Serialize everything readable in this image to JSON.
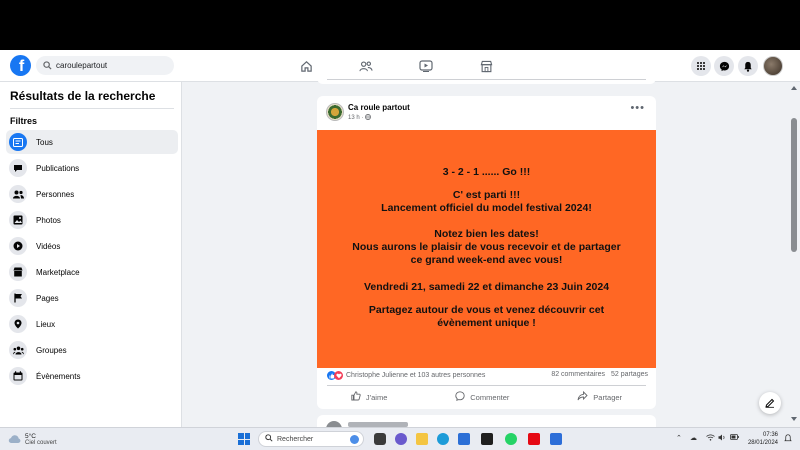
{
  "search": {
    "value": "caroulepartout"
  },
  "sidebar": {
    "title": "Résultats de la recherche",
    "filters_label": "Filtres",
    "items": [
      {
        "label": "Tous",
        "icon": "feed-icon",
        "active": true
      },
      {
        "label": "Publications",
        "icon": "posts-icon"
      },
      {
        "label": "Personnes",
        "icon": "people-icon"
      },
      {
        "label": "Photos",
        "icon": "photos-icon"
      },
      {
        "label": "Vidéos",
        "icon": "video-icon"
      },
      {
        "label": "Marketplace",
        "icon": "marketplace-icon"
      },
      {
        "label": "Pages",
        "icon": "flag-icon"
      },
      {
        "label": "Lieux",
        "icon": "location-icon"
      },
      {
        "label": "Groupes",
        "icon": "groups-icon"
      },
      {
        "label": "Évènements",
        "icon": "calendar-icon"
      }
    ]
  },
  "post": {
    "author": "Ca roule partout",
    "time": "13 h ·",
    "banner": {
      "line1": "3 - 2 - 1 ...... Go !!!",
      "line2a": "C' est parti !!!",
      "line2b": "Lancement officiel du model festival 2024!",
      "line3a": "Notez bien les dates!",
      "line3b": "Nous aurons le plaisir de vous recevoir et de partager",
      "line3c": "ce grand week-end avec vous!",
      "line4": "Vendredi 21, samedi 22 et dimanche 23 Juin 2024",
      "line5a": "Partagez autour de vous et venez découvrir cet",
      "line5b": "évènement unique !"
    },
    "reactions_text": "Christophe Julienne et 103 autres personnes",
    "comments": "82 commentaires",
    "shares": "52 partages",
    "like_label": "J'aime",
    "comment_label": "Commenter",
    "share_label": "Partager"
  },
  "taskbar": {
    "temp": "5°C",
    "weather": "Ciel couvert",
    "search_label": "Rechercher",
    "time": "07:36",
    "date": "28/01/2024"
  },
  "colors": {
    "brand": "#1877f2",
    "banner": "#ff6724"
  }
}
